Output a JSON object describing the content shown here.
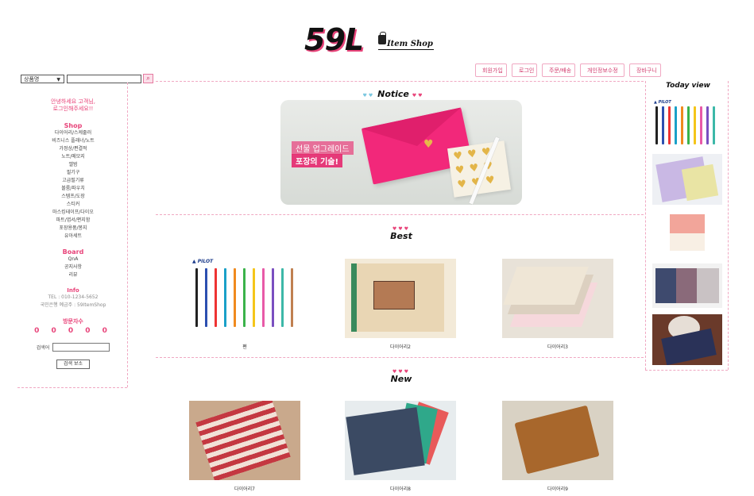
{
  "logo": {
    "big": "59L",
    "small": "Item Shop"
  },
  "nav": [
    "회원가입",
    "로그인",
    "주문/배송",
    "개인정보수정",
    "장바구니"
  ],
  "search": {
    "category": "상품명"
  },
  "sidebar": {
    "greeting1": "안녕하세요 고객님,",
    "greeting2": "로그인해주세요!!",
    "shop_title": "Shop",
    "shop_items": [
      "다이어리/스케줄러",
      "비즈니스 플래너/노트",
      "가정상/편결적",
      "노트/메모지",
      "앨범",
      "필기구",
      "고급필기류",
      "볼룸/파우치",
      "스템프/도장",
      "스티커",
      "마스킹테이프/다이오",
      "파트/엽서/편지함",
      "포장용품/봉지",
      "유아세트"
    ],
    "board_title": "Board",
    "board_items": [
      "QnA",
      "공지사항",
      "리뷰"
    ],
    "info_title": "Info",
    "info_tel": "TEL : 010-1234-5652",
    "info_bank": "국민은행 예금주 : 59ItemShop",
    "visitor_title": "방문자수",
    "visitor_count": "0 0 0 0 0",
    "login_label": "검색어",
    "button_label": "검색 보소"
  },
  "sections": {
    "notice": "Notice",
    "best": "Best",
    "new": "New",
    "today": "Today view"
  },
  "banner": {
    "line1": "선물 업그레이드",
    "line2": "포장의 기술!"
  },
  "best_products": [
    "펜",
    "다이어리2",
    "다이어리3"
  ],
  "new_products": [
    "다이어리7",
    "다이어리8",
    "다이어리9"
  ],
  "colors": {
    "accent": "#e8447a",
    "border": "#f0a8c2"
  }
}
